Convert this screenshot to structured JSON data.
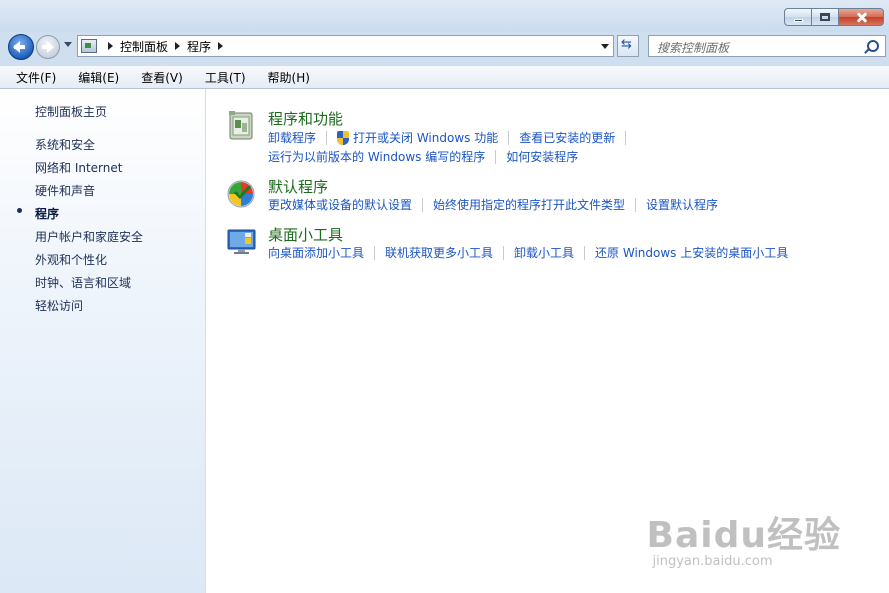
{
  "window": {
    "controls": [
      "minimize",
      "maximize",
      "close"
    ]
  },
  "nav": {
    "breadcrumb": [
      "控制面板",
      "程序"
    ],
    "search_placeholder": "搜索控制面板"
  },
  "menubar": {
    "items": [
      "文件(F)",
      "编辑(E)",
      "查看(V)",
      "工具(T)",
      "帮助(H)"
    ]
  },
  "sidebar": {
    "home": "控制面板主页",
    "items": [
      {
        "label": "系统和安全",
        "current": false
      },
      {
        "label": "网络和 Internet",
        "current": false
      },
      {
        "label": "硬件和声音",
        "current": false
      },
      {
        "label": "程序",
        "current": true
      },
      {
        "label": "用户帐户和家庭安全",
        "current": false
      },
      {
        "label": "外观和个性化",
        "current": false
      },
      {
        "label": "时钟、语言和区域",
        "current": false
      },
      {
        "label": "轻松访问",
        "current": false
      }
    ]
  },
  "main": {
    "sections": [
      {
        "icon": "programs-features-icon",
        "title": "程序和功能",
        "rows": [
          [
            "卸载程序",
            "打开或关闭 Windows 功能",
            "查看已安装的更新"
          ],
          [
            "运行为以前版本的 Windows 编写的程序",
            "如何安装程序"
          ]
        ]
      },
      {
        "icon": "default-programs-icon",
        "title": "默认程序",
        "rows": [
          [
            "更改媒体或设备的默认设置",
            "始终使用指定的程序打开此文件类型",
            "设置默认程序"
          ]
        ]
      },
      {
        "icon": "desktop-gadgets-icon",
        "title": "桌面小工具",
        "rows": [
          [
            "向桌面添加小工具",
            "联机获取更多小工具",
            "卸载小工具",
            "还原 Windows 上安装的桌面小工具"
          ]
        ]
      }
    ]
  },
  "watermark": {
    "logo": "Baidu经验",
    "url": "jingyan.baidu.com"
  }
}
